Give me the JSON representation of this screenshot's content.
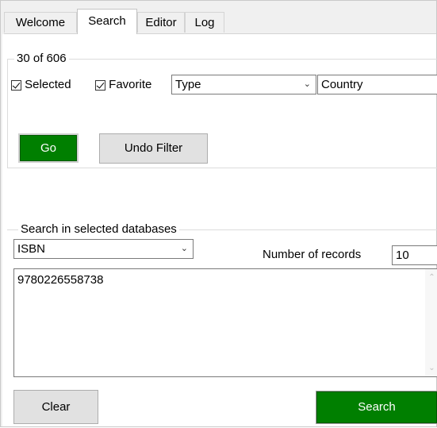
{
  "tabs": [
    {
      "label": "Welcome"
    },
    {
      "label": "Search"
    },
    {
      "label": "Editor"
    },
    {
      "label": "Log"
    }
  ],
  "filter": {
    "count_label": "30 of 606",
    "selected_label": "Selected",
    "selected_checked": true,
    "favorite_label": "Favorite",
    "favorite_checked": true,
    "type_value": "Type",
    "country_value": "Country",
    "go_label": "Go",
    "undo_label": "Undo Filter"
  },
  "search": {
    "group_title": "Search in selected databases",
    "field_value": "ISBN",
    "records_label": "Number of records",
    "records_value": "10",
    "query_text": "9780226558738",
    "clear_label": "Clear",
    "search_label": "Search"
  },
  "icons": {
    "chevron": "chevron-down-icon",
    "check": "checkmark-icon",
    "scroll_up": "scroll-up-arrow-icon",
    "scroll_down": "scroll-down-arrow-icon"
  },
  "colors": {
    "go_button": "#007f00",
    "search_button": "#007f00",
    "tab_active": "#ffffff",
    "tab_inactive": "#f0f0f0"
  }
}
